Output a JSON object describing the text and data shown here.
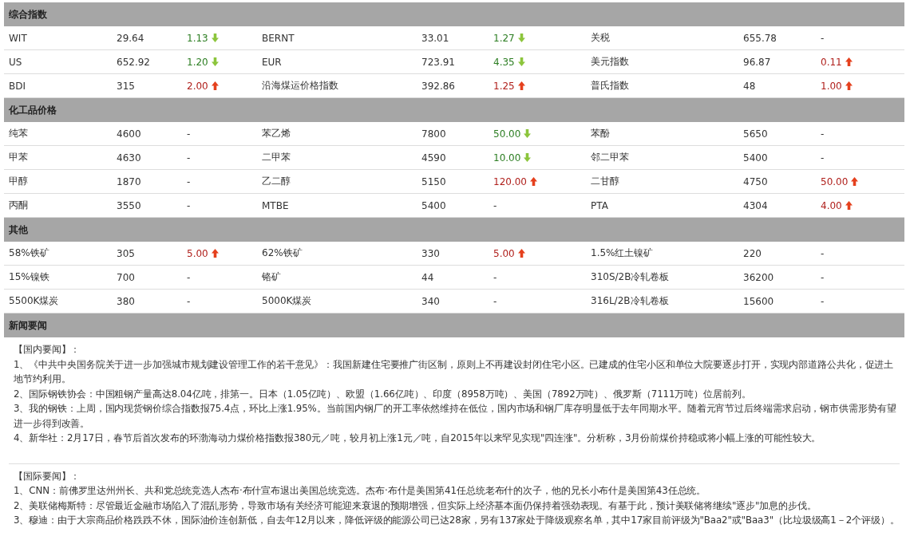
{
  "sections": [
    {
      "title": "综合指数",
      "rows": [
        [
          {
            "name": "WIT",
            "value": "29.64",
            "change": {
              "text": "1.13",
              "kind": "down"
            }
          },
          {
            "name": "BERNT",
            "value": "33.01",
            "change": {
              "text": "1.27",
              "kind": "down"
            }
          },
          {
            "name": "关税",
            "value": "655.78",
            "change": {
              "text": "-",
              "kind": "none"
            }
          }
        ],
        [
          {
            "name": "US",
            "value": "652.92",
            "change": {
              "text": "1.20",
              "kind": "down"
            }
          },
          {
            "name": "EUR",
            "value": "723.91",
            "change": {
              "text": "4.35",
              "kind": "down"
            }
          },
          {
            "name": "美元指数",
            "value": "96.87",
            "change": {
              "text": "0.11",
              "kind": "up"
            }
          }
        ],
        [
          {
            "name": "BDI",
            "value": "315",
            "change": {
              "text": "2.00",
              "kind": "up"
            }
          },
          {
            "name": "沿海煤运价格指数",
            "value": "392.86",
            "change": {
              "text": "1.25",
              "kind": "up"
            }
          },
          {
            "name": "普氏指数",
            "value": "48",
            "change": {
              "text": "1.00",
              "kind": "up"
            }
          }
        ]
      ]
    },
    {
      "title": "化工品价格",
      "rows": [
        [
          {
            "name": "纯苯",
            "value": "4600",
            "change": {
              "text": "-",
              "kind": "none"
            }
          },
          {
            "name": "苯乙烯",
            "value": "7800",
            "change": {
              "text": "50.00",
              "kind": "down"
            }
          },
          {
            "name": "苯酚",
            "value": "5650",
            "change": {
              "text": "-",
              "kind": "none"
            }
          }
        ],
        [
          {
            "name": "甲苯",
            "value": "4630",
            "change": {
              "text": "-",
              "kind": "none"
            }
          },
          {
            "name": "二甲苯",
            "value": "4590",
            "change": {
              "text": "10.00",
              "kind": "down"
            }
          },
          {
            "name": "邻二甲苯",
            "value": "5400",
            "change": {
              "text": "-",
              "kind": "none"
            }
          }
        ],
        [
          {
            "name": "甲醇",
            "value": "1870",
            "change": {
              "text": "-",
              "kind": "none"
            }
          },
          {
            "name": "乙二醇",
            "value": "5150",
            "change": {
              "text": "120.00",
              "kind": "up"
            }
          },
          {
            "name": "二甘醇",
            "value": "4750",
            "change": {
              "text": "50.00",
              "kind": "up"
            }
          }
        ],
        [
          {
            "name": "丙酮",
            "value": "3550",
            "change": {
              "text": "-",
              "kind": "none"
            }
          },
          {
            "name": "MTBE",
            "value": "5400",
            "change": {
              "text": "-",
              "kind": "none"
            }
          },
          {
            "name": "PTA",
            "value": "4304",
            "change": {
              "text": "4.00",
              "kind": "up"
            }
          }
        ]
      ]
    },
    {
      "title": "其他",
      "rows": [
        [
          {
            "name": "58%铁矿",
            "value": "305",
            "change": {
              "text": "5.00",
              "kind": "up"
            }
          },
          {
            "name": "62%铁矿",
            "value": "330",
            "change": {
              "text": "5.00",
              "kind": "up"
            }
          },
          {
            "name": "1.5%红土镍矿",
            "value": "220",
            "change": {
              "text": "-",
              "kind": "none"
            }
          }
        ],
        [
          {
            "name": "15%镍铁",
            "value": "700",
            "change": {
              "text": "-",
              "kind": "none"
            }
          },
          {
            "name": "铬矿",
            "value": "44",
            "change": {
              "text": "-",
              "kind": "none"
            }
          },
          {
            "name": "310S/2B冷轧卷板",
            "value": "36200",
            "change": {
              "text": "-",
              "kind": "none"
            }
          }
        ],
        [
          {
            "name": "5500K煤炭",
            "value": "380",
            "change": {
              "text": "-",
              "kind": "none"
            }
          },
          {
            "name": "5000K煤炭",
            "value": "340",
            "change": {
              "text": "-",
              "kind": "none"
            }
          },
          {
            "name": "316L/2B冷轧卷板",
            "value": "15600",
            "change": {
              "text": "-",
              "kind": "none"
            }
          }
        ]
      ]
    }
  ],
  "news": {
    "title": "新闻要闻",
    "groups": [
      {
        "heading": "【国内要闻】：",
        "items": [
          "1、《中共中央国务院关于进一步加强城市规划建设管理工作的若干意见》：我国新建住宅要推广街区制，原则上不再建设封闭住宅小区。已建成的住宅小区和单位大院要逐步打开，实现内部道路公共化，促进土地节约利用。",
          "2、国际钢铁协会：中国粗钢产量高达8.04亿吨，排第一。日本（1.05亿吨）、欧盟（1.66亿吨）、印度（8958万吨）、美国（7892万吨）、俄罗斯（7111万吨）位居前列。",
          "3、我的钢铁：上周，国内现货钢价综合指数报75.4点，环比上涨1.95%。当前国内钢厂的开工率依然维持在低位，国内市场和钢厂库存明显低于去年同期水平。随着元宵节过后终端需求启动，钢市供需形势有望进一步得到改善。",
          "4、新华社：2月17日，春节后首次发布的环渤海动力煤价格指数报380元／吨，较月初上涨1元／吨，自2015年以来罕见实现\"四连涨\"。分析称，3月份前煤价持稳或将小幅上涨的可能性较大。"
        ]
      },
      {
        "heading": "【国际要闻】：",
        "items": [
          "1、CNN：前佛罗里达州州长、共和党总统竞选人杰布·布什宣布退出美国总统竞选。杰布·布什是美国第41任总统老布什的次子，他的兄长小布什是美国第43任总统。",
          "2、美联储梅斯特：尽管最近金融市场陷入了混乱形势，导致市场有关经济可能迎来衰退的预期增强，但实际上经济基本面仍保持着强劲表现。有基于此，预计美联储将继续\"逐步\"加息的步伐。",
          "3、穆迪：由于大宗商品价格跌跌不休，国际油价连创新低，自去年12月以来，降低评级的能源公司已达28家，另有137家处于降级观察名单，其中17家目前评级为\"Baa2\"或\"Baa3\"（比垃圾级高1－2个评级）。"
        ]
      }
    ]
  }
}
